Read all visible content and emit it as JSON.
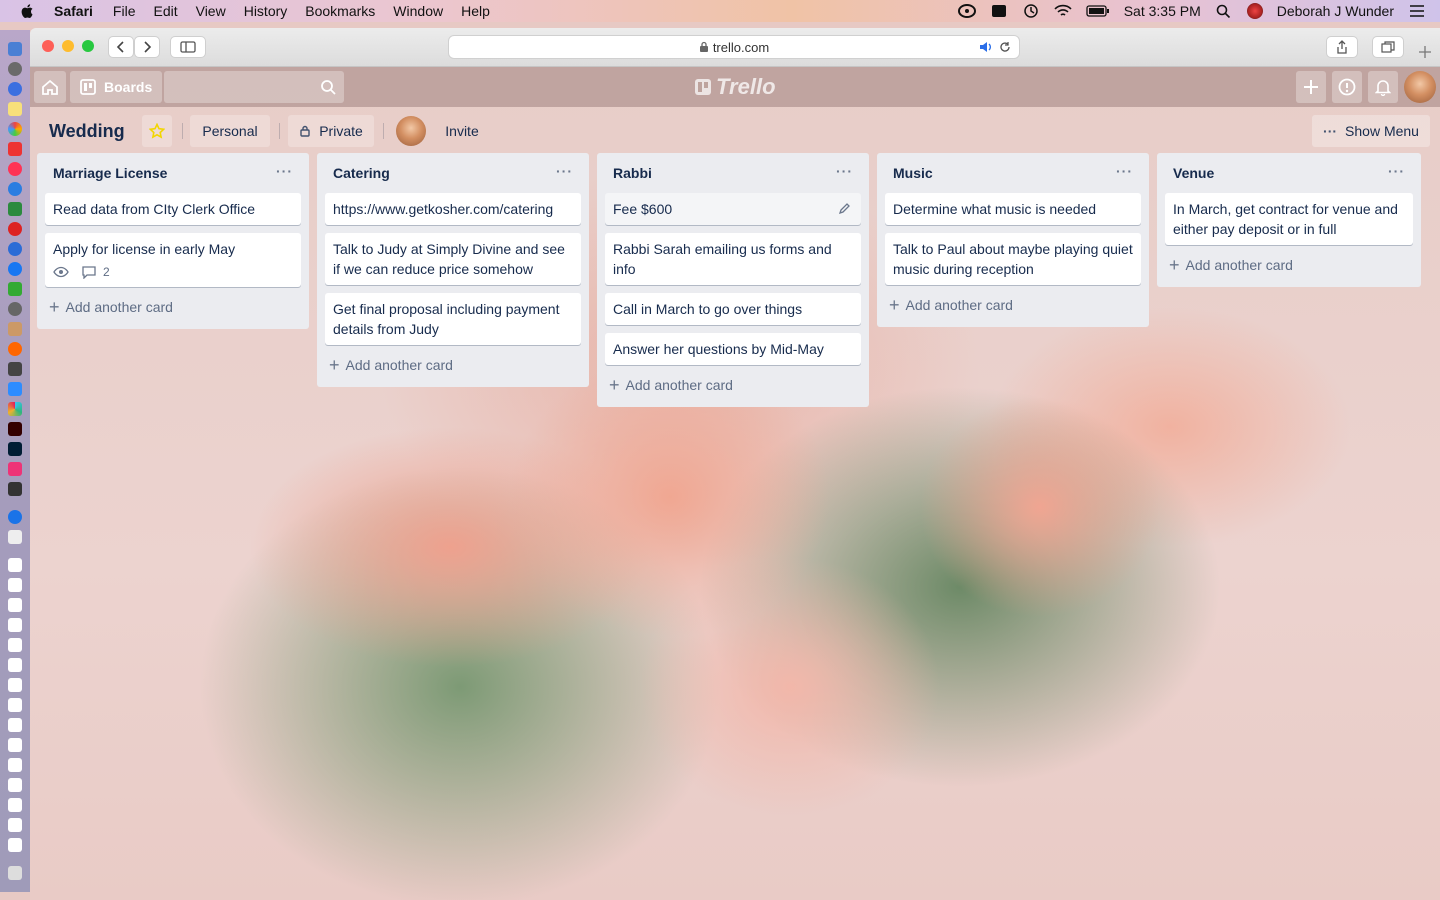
{
  "menubar": {
    "app": "Safari",
    "items": [
      "File",
      "Edit",
      "View",
      "History",
      "Bookmarks",
      "Window",
      "Help"
    ],
    "clock": "Sat 3:35 PM",
    "user": "Deborah J Wunder"
  },
  "browser": {
    "url": "trello.com"
  },
  "header": {
    "boards_label": "Boards",
    "logo_text": "Trello"
  },
  "board": {
    "title": "Wedding",
    "team_label": "Personal",
    "visibility_label": "Private",
    "invite_label": "Invite",
    "show_menu_label": "Show Menu"
  },
  "lists": [
    {
      "title": "Marriage License",
      "cards": [
        {
          "text": "Read data from CIty Clerk Office"
        },
        {
          "text": "Apply for license in early May",
          "comments": "2"
        }
      ],
      "add_label": "Add another card"
    },
    {
      "title": "Catering",
      "cards": [
        {
          "text": "https://www.getkosher.com/catering"
        },
        {
          "text": "Talk to Judy at Simply Divine and see if we can reduce price somehow"
        },
        {
          "text": "Get final proposal including payment details from Judy"
        }
      ],
      "add_label": "Add another card"
    },
    {
      "title": "Rabbi",
      "cards": [
        {
          "text": "Fee $600"
        },
        {
          "text": "Rabbi Sarah emailing us forms and info"
        },
        {
          "text": "Call in March to go over things"
        },
        {
          "text": "Answer her questions by Mid-May"
        }
      ],
      "add_label": "Add another card"
    },
    {
      "title": "Music",
      "cards": [
        {
          "text": "Determine what music is needed"
        },
        {
          "text": "Talk to Paul about maybe playing quiet music during reception"
        }
      ],
      "add_label": "Add another card"
    },
    {
      "title": "Venue",
      "cards": [
        {
          "text": "In March, get contract for venue and either pay deposit or in full"
        }
      ],
      "add_label": "Add another card"
    }
  ],
  "colors": {
    "list_bg": "#ebecf0",
    "text": "#172b4d",
    "star": "#f2d600"
  }
}
